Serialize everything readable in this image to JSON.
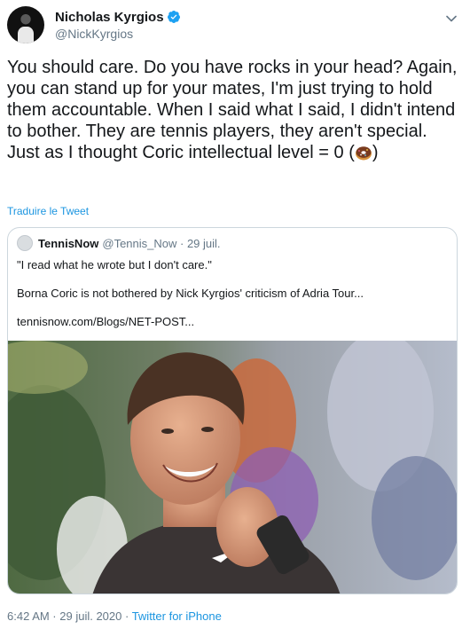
{
  "author": {
    "display_name": "Nicholas Kyrgios",
    "handle": "@NickKyrgios"
  },
  "tweet": {
    "text": "You should care. Do you have rocks in your head? Again, you can stand up for your mates, I'm just trying to hold them accountable. When I said what I said, I didn't intend to bother. They are tennis players, they aren't special. Just as I thought Coric intellectual level = 0 (",
    "text_end": ")",
    "emoji": "donut-emoji",
    "translate_link": "Traduire le Tweet",
    "timestamp": "6:42 AM · 29 juil. 2020 · ",
    "source": "Twitter for iPhone"
  },
  "quoted_tweet": {
    "display_name": "TennisNow",
    "handle": "@Tennis_Now · 29 juil.",
    "quote_line": "\"I read what he wrote but I don't care.\"",
    "headline": "Borna Coric is not bothered by Nick Kyrgios' criticism of Adria Tour...",
    "link": "tennisnow.com/Blogs/NET-POST..."
  },
  "colors": {
    "link": "#1b95e0",
    "secondary_text": "#657786",
    "verified_badge": "#1da1f2",
    "border": "#ccd6dd"
  },
  "icons": {
    "verified": "verified-badge-icon",
    "menu": "chevron-down-icon"
  }
}
